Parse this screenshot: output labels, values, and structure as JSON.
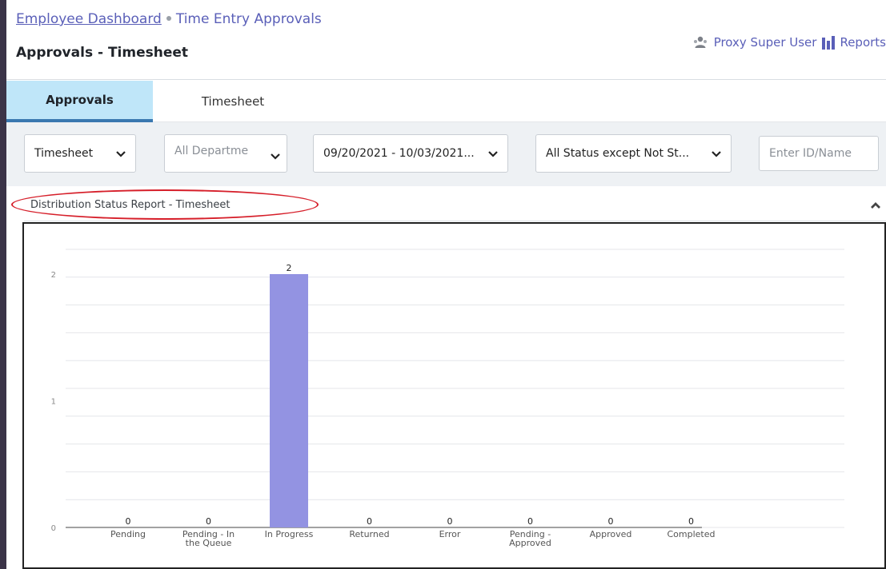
{
  "breadcrumb": {
    "home": "Employee Dashboard",
    "current": "Time Entry Approvals"
  },
  "page_title": "Approvals - Timesheet",
  "top_actions": {
    "proxy": "Proxy Super User",
    "reports": "Reports"
  },
  "tabs": [
    {
      "label": "Approvals",
      "active": true
    },
    {
      "label": "Timesheet",
      "active": false
    }
  ],
  "filters": {
    "type": "Timesheet",
    "department": "All Departme",
    "date_range": "09/20/2021 - 10/03/2021...",
    "status": "All Status except Not St...",
    "id_placeholder": "Enter ID/Name"
  },
  "panel": {
    "title": "Distribution Status Report - Timesheet"
  },
  "colors": {
    "accent": "#5a5fb8",
    "bar": "#9393e2",
    "tab_active": "#bfe6f9",
    "highlight": "#d61f2a"
  },
  "chart_data": {
    "type": "bar",
    "categories": [
      [
        "Pending"
      ],
      [
        "Pending - In",
        "the Queue"
      ],
      [
        "In Progress"
      ],
      [
        "Returned"
      ],
      [
        "Error"
      ],
      [
        "Pending -",
        "Approved"
      ],
      [
        "Approved"
      ],
      [
        "Completed"
      ]
    ],
    "values": [
      0,
      0,
      2,
      0,
      0,
      0,
      0,
      0
    ],
    "ylim": [
      0,
      2
    ],
    "yticks": [
      0,
      1,
      2
    ],
    "grid": true,
    "data_labels": true
  }
}
